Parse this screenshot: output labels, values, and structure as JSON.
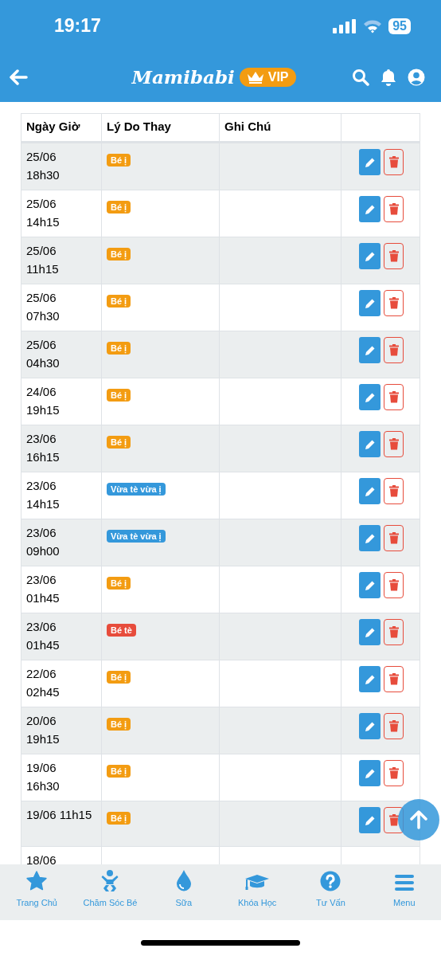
{
  "status_bar": {
    "time": "19:17",
    "battery": "95"
  },
  "header": {
    "logo": "Mamibabi",
    "badge": "VIP"
  },
  "table": {
    "columns": [
      "Ngày Giờ",
      "Lý Do Thay",
      "Ghi Chú"
    ],
    "rows": [
      {
        "datetime": "25/06\n18h30",
        "reason": {
          "text": "Bé ị",
          "kind": "poop"
        }
      },
      {
        "datetime": "25/06\n14h15",
        "reason": {
          "text": "Bé ị",
          "kind": "poop"
        }
      },
      {
        "datetime": "25/06\n11h15",
        "reason": {
          "text": "Bé ị",
          "kind": "poop"
        }
      },
      {
        "datetime": "25/06\n07h30",
        "reason": {
          "text": "Bé ị",
          "kind": "poop"
        }
      },
      {
        "datetime": "25/06\n04h30",
        "reason": {
          "text": "Bé ị",
          "kind": "poop"
        }
      },
      {
        "datetime": "24/06\n19h15",
        "reason": {
          "text": "Bé ị",
          "kind": "poop"
        }
      },
      {
        "datetime": "23/06\n16h15",
        "reason": {
          "text": "Bé ị",
          "kind": "poop"
        }
      },
      {
        "datetime": "23/06\n14h15",
        "reason": {
          "text": "Vừa tè vừa ị",
          "kind": "both"
        }
      },
      {
        "datetime": "23/06\n09h00",
        "reason": {
          "text": "Vừa tè vừa ị",
          "kind": "both"
        }
      },
      {
        "datetime": "23/06\n01h45",
        "reason": {
          "text": "Bé ị",
          "kind": "poop"
        }
      },
      {
        "datetime": "23/06\n01h45",
        "reason": {
          "text": "Bé tè",
          "kind": "pee"
        }
      },
      {
        "datetime": "22/06\n02h45",
        "reason": {
          "text": "Bé ị",
          "kind": "poop"
        }
      },
      {
        "datetime": "20/06\n19h15",
        "reason": {
          "text": "Bé ị",
          "kind": "poop"
        }
      },
      {
        "datetime": "19/06\n16h30",
        "reason": {
          "text": "Bé ị",
          "kind": "poop"
        }
      },
      {
        "datetime": "19/06 11h15",
        "reason": {
          "text": "Bé ị",
          "kind": "poop"
        }
      },
      {
        "datetime": "18/06"
      }
    ]
  },
  "tab_bar": [
    {
      "label": "Trang Chủ"
    },
    {
      "label": "Chăm Sóc Bé"
    },
    {
      "label": "Sữa"
    },
    {
      "label": "Khóa Học"
    },
    {
      "label": "Tư Vấn"
    },
    {
      "label": "Menu"
    }
  ]
}
